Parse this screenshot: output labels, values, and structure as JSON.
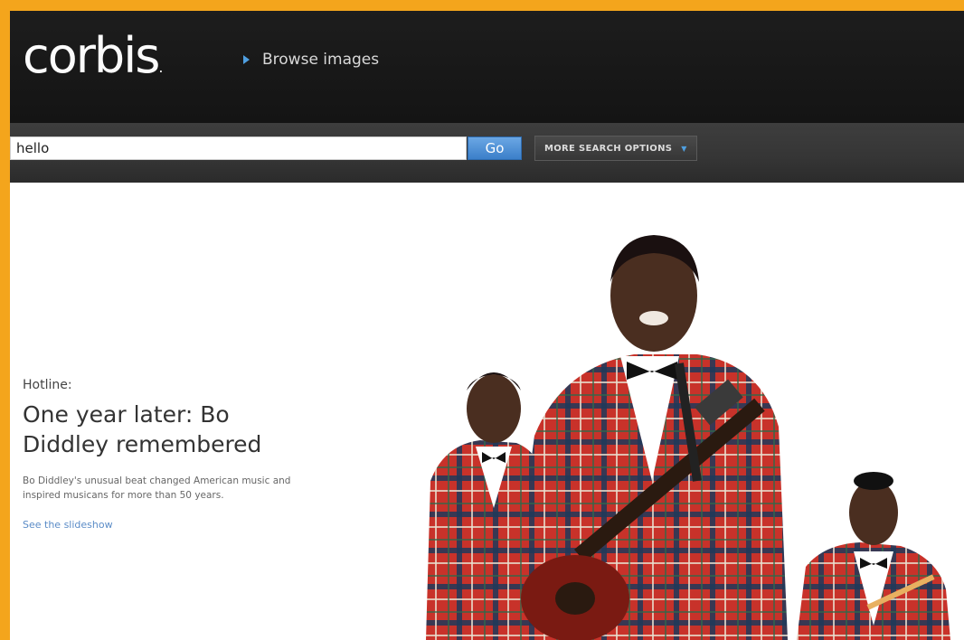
{
  "header": {
    "logo_text": "corbis",
    "logo_dot": ".",
    "browse_label": "Browse images"
  },
  "search": {
    "value": "hello",
    "go_label": "Go",
    "more_options_label": "MORE SEARCH OPTIONS"
  },
  "feature": {
    "kicker": "Hotline:",
    "headline": "One year later: Bo Diddley remembered",
    "description": "Bo Diddley's unusual beat changed American music and inspired musicans for more than 50 years.",
    "link_label": "See the slideshow"
  },
  "colors": {
    "frame_border": "#f4a51c",
    "header_bg": "#1a1a1a",
    "go_button": "#4a8ed6",
    "link": "#5b8cc7",
    "jacket_red": "#c8322a"
  },
  "icons": {
    "browse": "triangle-right-icon",
    "more_options": "chevron-down-icon"
  }
}
